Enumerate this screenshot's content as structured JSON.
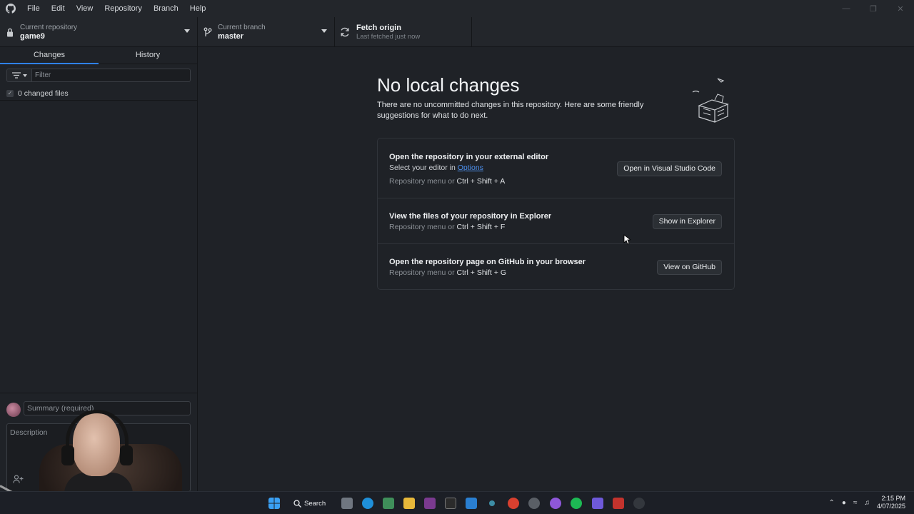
{
  "menu": [
    "File",
    "Edit",
    "View",
    "Repository",
    "Branch",
    "Help"
  ],
  "toolbar": {
    "repo_label": "Current repository",
    "repo_value": "game9",
    "branch_label": "Current branch",
    "branch_value": "master",
    "fetch_title": "Fetch origin",
    "fetch_sub": "Last fetched just now"
  },
  "sidebar": {
    "tabs": [
      "Changes",
      "History"
    ],
    "filter_placeholder": "Filter",
    "changed_files": "0 changed files",
    "summary_placeholder": "Summary (required)",
    "description_placeholder": "Description"
  },
  "main": {
    "heading": "No local changes",
    "lede": "There are no uncommitted changes in this repository. Here are some friendly suggestions for what to do next.",
    "suggestions": [
      {
        "title": "Open the repository in your external editor",
        "line_prefix": "Select your editor in ",
        "line_link": "Options",
        "hint_prefix": "Repository menu or ",
        "shortcut": "Ctrl + Shift + A",
        "button": "Open in Visual Studio Code"
      },
      {
        "title": "View the files of your repository in Explorer",
        "hint_prefix": "Repository menu or ",
        "shortcut": "Ctrl + Shift + F",
        "button": "Show in Explorer"
      },
      {
        "title": "Open the repository page on GitHub in your browser",
        "hint_prefix": "Repository menu or ",
        "shortcut": "Ctrl + Shift + G",
        "button": "View on GitHub"
      }
    ]
  },
  "taskbar": {
    "search_label": "Search",
    "time": "2:15 PM",
    "date": "4/07/2025"
  },
  "colors": {
    "accent": "#2f81f7",
    "background": "#1f2227",
    "link": "#4c8eea"
  }
}
